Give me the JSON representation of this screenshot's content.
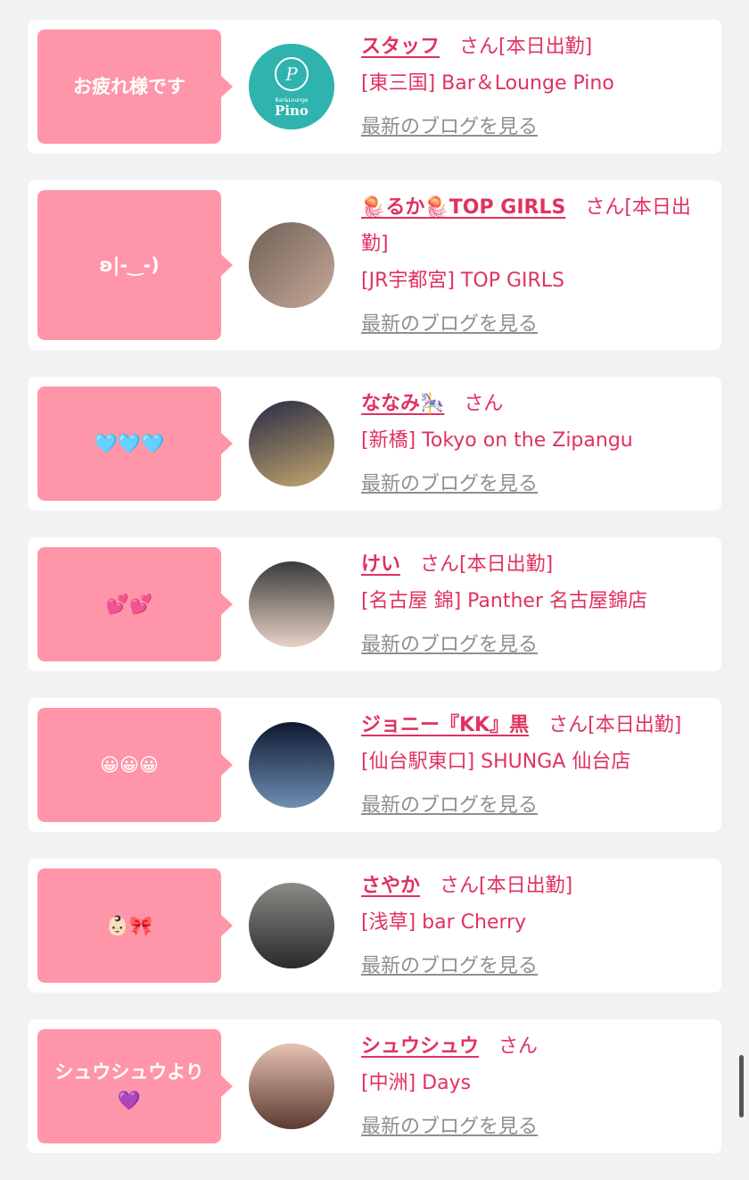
{
  "entries": [
    {
      "bubble": "お疲れ様です",
      "name": "スタッフ",
      "san": "さん",
      "status": "[本日出勤]",
      "shop": "[東三国] Bar＆Lounge Pino",
      "blog": "最新のブログを見る",
      "avatar_logo_top": "Bar&Lounge",
      "avatar_logo_bottom": "Pino",
      "avatar_colors": [
        "#2fb3ae",
        "#1e8f8b"
      ]
    },
    {
      "bubble": "ʚ|-‿-)",
      "name": "🪼るか🪼TOP GIRLS",
      "san": "さん",
      "status": "[本日出勤]",
      "shop": "[JR宇都宮] TOP GIRLS",
      "blog": "最新のブログを見る",
      "avatar_colors": [
        "#6d6156",
        "#c9a99a"
      ]
    },
    {
      "bubble": "🩵🩵🩵",
      "name": "ななみ🎠",
      "san": "さん",
      "status": "",
      "shop": "[新橋] Tokyo on the Zipangu",
      "blog": "最新のブログを見る",
      "avatar_colors": [
        "#262a45",
        "#c6a870"
      ]
    },
    {
      "bubble": "💕💕",
      "name": "けい",
      "san": "さん",
      "status": "[本日出勤]",
      "shop": "[名古屋 錦] Panther 名古屋錦店",
      "blog": "最新のブログを見る",
      "avatar_colors": [
        "#3b3b3b",
        "#e8d2c6"
      ]
    },
    {
      "bubble": "😀😀😀",
      "name": "ジョニー『KK』黒",
      "san": "さん",
      "status": "[本日出勤]",
      "shop": "[仙台駅東口] SHUNGA 仙台店",
      "blog": "最新のブログを見る",
      "avatar_colors": [
        "#0e1830",
        "#6f8fb4"
      ]
    },
    {
      "bubble": "👶🏻🎀",
      "name": "さやか",
      "san": "さん",
      "status": "[本日出勤]",
      "shop": "[浅草] bar Cherry",
      "blog": "最新のブログを見る",
      "avatar_colors": [
        "#8c8a86",
        "#2a2a2a"
      ]
    },
    {
      "bubble": "シュウシュウより\n💜",
      "name": "シュウシュウ",
      "san": "さん",
      "status": "",
      "shop": "[中洲] Days",
      "blog": "最新のブログを見る",
      "avatar_colors": [
        "#e6c2b2",
        "#5a3a32"
      ]
    }
  ]
}
